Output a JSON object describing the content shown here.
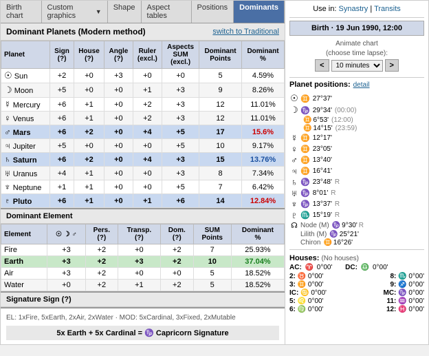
{
  "tabs": [
    {
      "label": "Birth chart",
      "active": false
    },
    {
      "label": "Custom graphics",
      "active": false,
      "dropdown": true
    },
    {
      "label": "Shape",
      "active": false
    },
    {
      "label": "Aspect tables",
      "active": false
    },
    {
      "label": "Positions",
      "active": false
    },
    {
      "label": "Dominants",
      "active": true
    }
  ],
  "dominant_planets": {
    "title": "Dominant Planets (Modern method)",
    "switch_link": "switch to Traditional",
    "columns": [
      "Planet",
      "Sign (?)",
      "House (?)",
      "Angle (?)",
      "Ruler (excl.)",
      "Aspects SUM (excl.)",
      "Dominant Points",
      "Dominant %"
    ],
    "rows": [
      {
        "symbol": "☉",
        "name": "Sun",
        "sign": "+2",
        "house": "+0",
        "angle": "+3",
        "ruler": "+0",
        "aspects": "+0",
        "points": "5",
        "pct": "4.59%",
        "bold": false
      },
      {
        "symbol": "☽",
        "name": "Moon",
        "sign": "+5",
        "house": "+0",
        "angle": "+0",
        "ruler": "+1",
        "aspects": "+3",
        "points": "9",
        "pct": "8.26%",
        "bold": false
      },
      {
        "symbol": "☿",
        "name": "Mercury",
        "sign": "+6",
        "house": "+1",
        "angle": "+0",
        "ruler": "+2",
        "aspects": "+3",
        "points": "12",
        "pct": "11.01%",
        "bold": false
      },
      {
        "symbol": "♀",
        "name": "Venus",
        "sign": "+6",
        "house": "+1",
        "angle": "+0",
        "ruler": "+2",
        "aspects": "+3",
        "points": "12",
        "pct": "11.01%",
        "bold": false
      },
      {
        "symbol": "♂",
        "name": "Mars",
        "sign": "+6",
        "house": "+2",
        "angle": "+0",
        "ruler": "+4",
        "aspects": "+5",
        "points": "17",
        "pct": "15.6%",
        "bold": true,
        "highlight": true
      },
      {
        "symbol": "♃",
        "name": "Jupiter",
        "sign": "+5",
        "house": "+0",
        "angle": "+0",
        "ruler": "+0",
        "aspects": "+5",
        "points": "10",
        "pct": "9.17%",
        "bold": false
      },
      {
        "symbol": "♄",
        "name": "Saturn",
        "sign": "+6",
        "house": "+2",
        "angle": "+0",
        "ruler": "+4",
        "aspects": "+3",
        "points": "15",
        "pct": "13.76%",
        "bold": true,
        "highlight2": true
      },
      {
        "symbol": "♅",
        "name": "Uranus",
        "sign": "+4",
        "house": "+1",
        "angle": "+0",
        "ruler": "+0",
        "aspects": "+3",
        "points": "8",
        "pct": "7.34%",
        "bold": false
      },
      {
        "symbol": "♆",
        "name": "Neptune",
        "sign": "+1",
        "house": "+1",
        "angle": "+0",
        "ruler": "+0",
        "aspects": "+5",
        "points": "7",
        "pct": "6.42%",
        "bold": false
      },
      {
        "symbol": "♇",
        "name": "Pluto",
        "sign": "+6",
        "house": "+1",
        "angle": "+0",
        "ruler": "+1",
        "aspects": "+6",
        "points": "14",
        "pct": "12.84%",
        "bold": true,
        "highlight3": true
      }
    ]
  },
  "dominant_element": {
    "title": "Dominant Element",
    "columns": [
      "Element",
      "☉ ☽ ♂",
      "Pers. (?)",
      "Transp. (?)",
      "Dom. (?)",
      "SUM Points",
      "Dominant %"
    ],
    "rows": [
      {
        "name": "Fire",
        "col1": "+3",
        "col2": "+2",
        "col3": "+0",
        "col4": "+2",
        "points": "7",
        "pct": "25.93%",
        "bold": false
      },
      {
        "name": "Earth",
        "col1": "+3",
        "col2": "+2",
        "col3": "+3",
        "col4": "+2",
        "points": "10",
        "pct": "37.04%",
        "bold": true,
        "highlight": true
      },
      {
        "name": "Air",
        "col1": "+3",
        "col2": "+2",
        "col3": "+0",
        "col4": "+0",
        "points": "5",
        "pct": "18.52%",
        "bold": false
      },
      {
        "name": "Water",
        "col1": "+0",
        "col2": "+2",
        "col3": "+1",
        "col4": "+2",
        "points": "5",
        "pct": "18.52%",
        "bold": false
      }
    ]
  },
  "signature": {
    "title": "Signature Sign (?)",
    "el_line": "EL: 1xFire, 5xEarth, 2xAir, 2xWater · MOD: 5xCardinal, 3xFixed, 2xMutable",
    "result_line": "5x Earth + 5x Cardinal = ♑ Capricorn Signature"
  },
  "right_panel": {
    "use_in_label": "Use in:",
    "synastry": "Synastry",
    "transits": "Transits",
    "birth_label": "Birth · 19 Jun 1990, 12:00",
    "animate_label": "Animate chart",
    "animate_sublabel": "(choose time lapse):",
    "animate_prev": "<",
    "animate_next": ">",
    "animate_option": "10 minutes",
    "planet_positions_label": "Planet positions:",
    "planet_positions_link": "detail",
    "planets": [
      {
        "symbol": "☉",
        "sign": "♊",
        "deg": "27°37'",
        "time": "",
        "r": ""
      },
      {
        "symbol": "☽",
        "sign": "♑",
        "deg": "29°34'",
        "time": "(00:00)",
        "r": ""
      },
      {
        "symbol": "",
        "sign": "♊",
        "deg": "6°53'",
        "time": "(12:00)",
        "r": ""
      },
      {
        "symbol": "",
        "sign": "♊",
        "deg": "14°15'",
        "time": "(23:59)",
        "r": ""
      },
      {
        "symbol": "☿",
        "sign": "♊",
        "deg": "12°17'",
        "time": "",
        "r": ""
      },
      {
        "symbol": "♀",
        "sign": "♊",
        "deg": "23°05'",
        "time": "",
        "r": ""
      },
      {
        "symbol": "♂",
        "sign": "♊",
        "deg": "13°40'",
        "time": "",
        "r": ""
      },
      {
        "symbol": "♃",
        "sign": "♊",
        "deg": "16°41'",
        "time": "",
        "r": ""
      },
      {
        "symbol": "♄",
        "sign": "♑",
        "deg": "23°48'",
        "time": "",
        "r": "R"
      },
      {
        "symbol": "♅",
        "sign": "♑",
        "deg": "8°01'",
        "time": "",
        "r": "R"
      },
      {
        "symbol": "♆",
        "sign": "♑",
        "deg": "13°37'",
        "time": "",
        "r": "R"
      },
      {
        "symbol": "♇",
        "sign": "♏",
        "deg": "15°19'",
        "time": "",
        "r": "R"
      },
      {
        "symbol": "☊",
        "sign": "♑",
        "deg": "9°30'",
        "time": "",
        "r": "R",
        "label": "Node (M)"
      },
      {
        "symbol": "",
        "sign": "♑",
        "deg": "25°21'",
        "time": "",
        "r": "",
        "label": "Lilith (M)"
      },
      {
        "symbol": "",
        "sign": "♊",
        "deg": "16°26'",
        "time": "",
        "r": "",
        "label": "Chiron"
      }
    ],
    "houses_label": "Houses:",
    "houses_note": "(No houses)",
    "ac_label": "AC:",
    "ac_sign": "♈",
    "ac_deg": "0°00'",
    "dc_label": "DC:",
    "dc_sign": "♎",
    "dc_deg": "0°00'",
    "house_pairs": [
      {
        "n1": "2:",
        "s1": "♉",
        "d1": "0°00'",
        "n2": "8:",
        "s2": "♏",
        "d2": "0°00'"
      },
      {
        "n1": "3:",
        "s1": "♊",
        "d1": "0°00'",
        "n2": "9:",
        "s2": "♐",
        "d2": "0°00'"
      },
      {
        "n1": "IC:",
        "s1": "♋",
        "d1": "0°00'",
        "n2": "MC:",
        "s2": "♑",
        "d2": "0°00'"
      },
      {
        "n1": "5:",
        "s1": "♌",
        "d1": "0°00'",
        "n2": "11:",
        "s2": "♒",
        "d2": "0°00'"
      },
      {
        "n1": "6:",
        "s1": "♍",
        "d1": "0°00'",
        "n2": "12:",
        "s2": "♓",
        "d2": "0°00'"
      }
    ]
  }
}
